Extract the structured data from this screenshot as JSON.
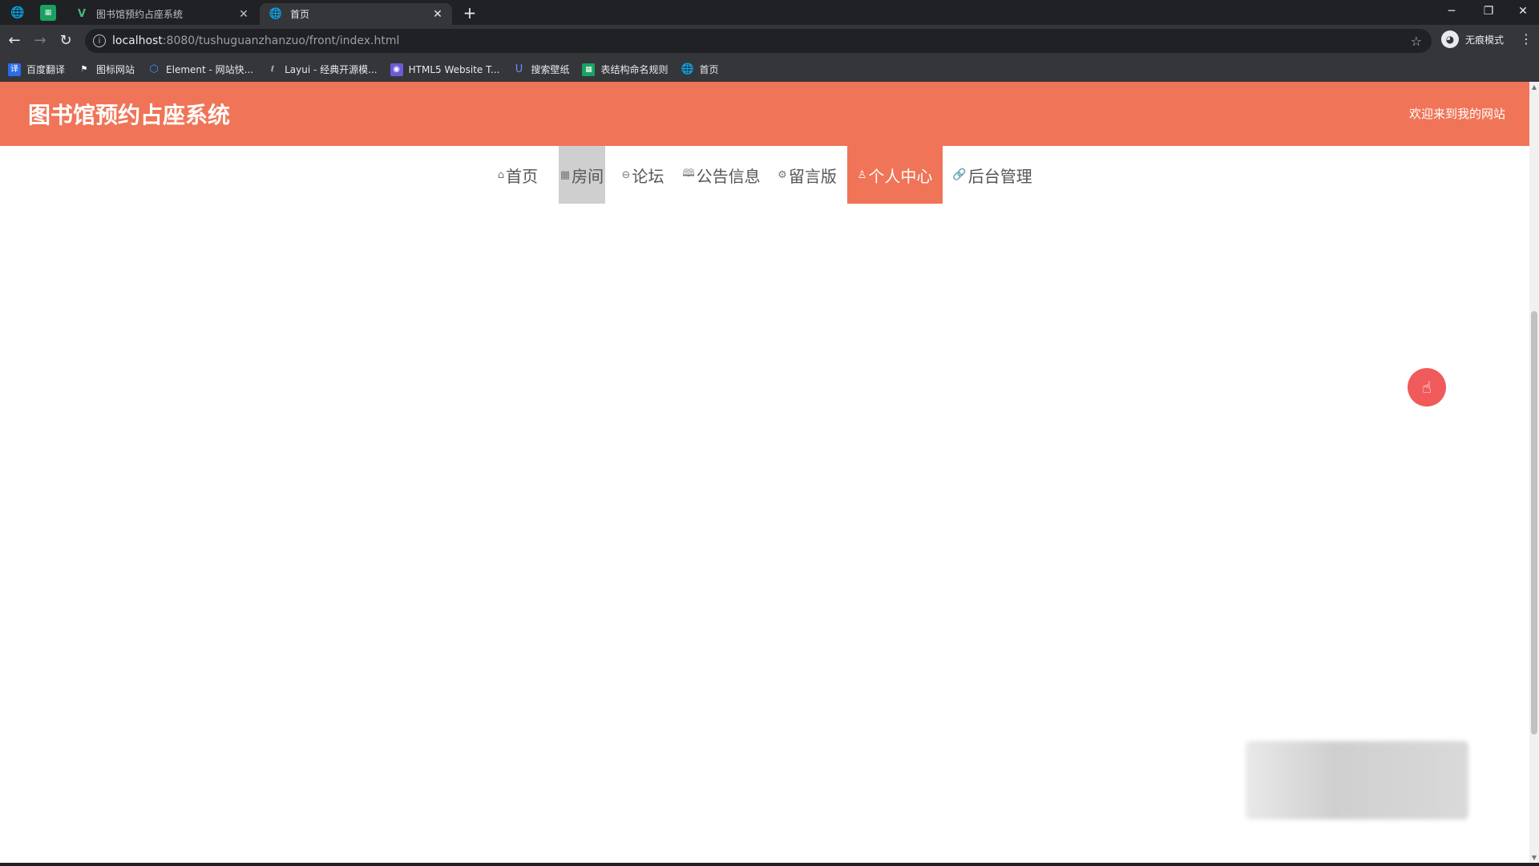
{
  "browser": {
    "tabs": [
      {
        "title": "图书馆预约占座系统",
        "active": false
      },
      {
        "title": "首页",
        "active": true
      }
    ],
    "url_host": "localhost",
    "url_rest": ":8080/tushuguanzhanzuo/front/index.html",
    "profile_label": "无痕模式",
    "bookmarks": [
      {
        "label": "百度翻译",
        "color": "#2b6de8"
      },
      {
        "label": "图标网站",
        "color": "#ffffff"
      },
      {
        "label": "Element - 网站快...",
        "color": "#3f8cff"
      },
      {
        "label": "Layui - 经典开源模...",
        "color": "#ffffff"
      },
      {
        "label": "HTML5 Website T...",
        "color": "#6b5bd6"
      },
      {
        "label": "搜索壁纸",
        "color": "#3f5fd8"
      },
      {
        "label": "表结构命名规则",
        "color": "#1aa260"
      },
      {
        "label": "首页",
        "color": "#e8eaed"
      }
    ]
  },
  "site": {
    "title": "图书馆预约占座系统",
    "welcome": "欢迎来到我的网站",
    "accent_color": "#f07457",
    "nav": [
      {
        "label": "首页",
        "icon": "home-icon",
        "state": "normal"
      },
      {
        "label": "房间",
        "icon": "room-icon",
        "state": "hover"
      },
      {
        "label": "论坛",
        "icon": "forum-icon",
        "state": "normal"
      },
      {
        "label": "公告信息",
        "icon": "book-icon",
        "state": "normal"
      },
      {
        "label": "留言版",
        "icon": "gear-icon",
        "state": "normal"
      },
      {
        "label": "个人中心",
        "icon": "user-icon",
        "state": "active"
      },
      {
        "label": "后台管理",
        "icon": "link-icon",
        "state": "normal"
      }
    ]
  }
}
